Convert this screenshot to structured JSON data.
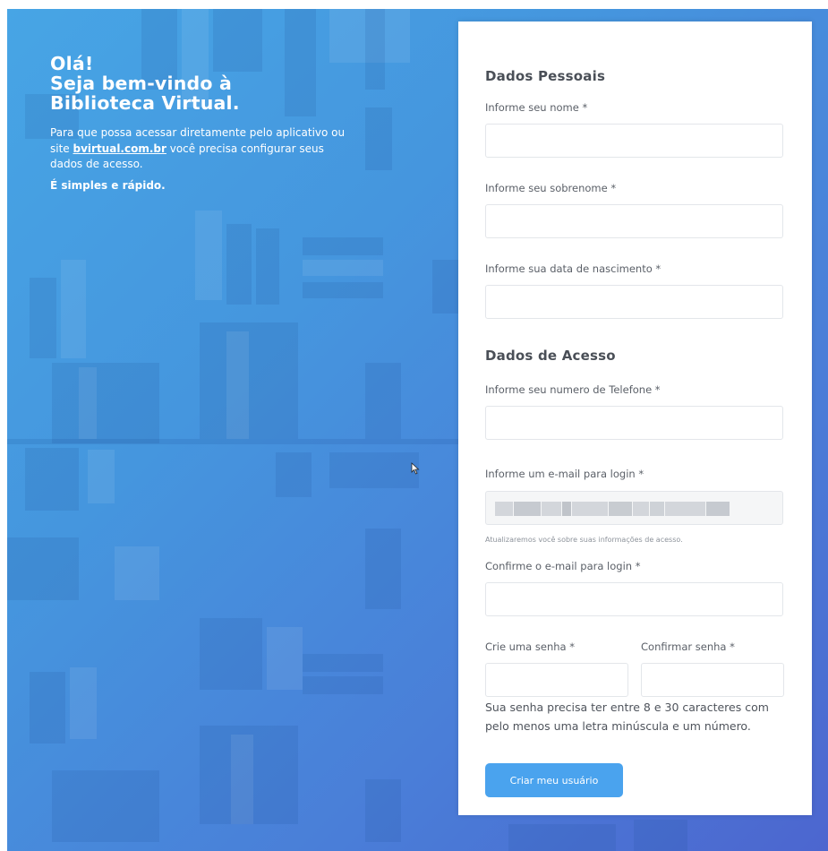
{
  "intro": {
    "heading_line1": "Olá!",
    "heading_line2": "Seja bem-vindo à",
    "heading_line3": "Biblioteca Virtual.",
    "text_before_link": "Para que possa acessar diretamente pelo aplicativo ou site ",
    "link_text": "bvirtual.com.br",
    "text_after_link": " você precisa configurar seus dados de acesso.",
    "note": "É simples e rápido."
  },
  "form": {
    "personal_title": "Dados Pessoais",
    "name_label": "Informe seu nome *",
    "name_value": "",
    "surname_label": "Informe seu sobrenome *",
    "surname_value": "",
    "birth_label": "Informe sua data de nascimento *",
    "birth_value": "",
    "access_title": "Dados de Acesso",
    "phone_label": "Informe seu numero de Telefone *",
    "phone_value": "",
    "email_label": "Informe um e-mail para login *",
    "email_hint": "Atualizaremos você sobre suas informações de acesso.",
    "email_confirm_label": "Confirme o e-mail para login *",
    "email_confirm_value": "",
    "password_label": "Crie uma senha *",
    "password_value": "",
    "password_confirm_label": "Confirmar senha *",
    "password_confirm_value": "",
    "password_note": "Sua senha precisa ter entre 8 e 30 caracteres com pelo menos uma letra minúscula e um número.",
    "submit_label": "Criar meu usuário"
  },
  "colors": {
    "background_start": "#47a5e5",
    "background_end": "#4c66cf",
    "button": "#4aa3ee",
    "card": "#ffffff"
  },
  "icons": {
    "cursor": "mouse-pointer-icon"
  }
}
